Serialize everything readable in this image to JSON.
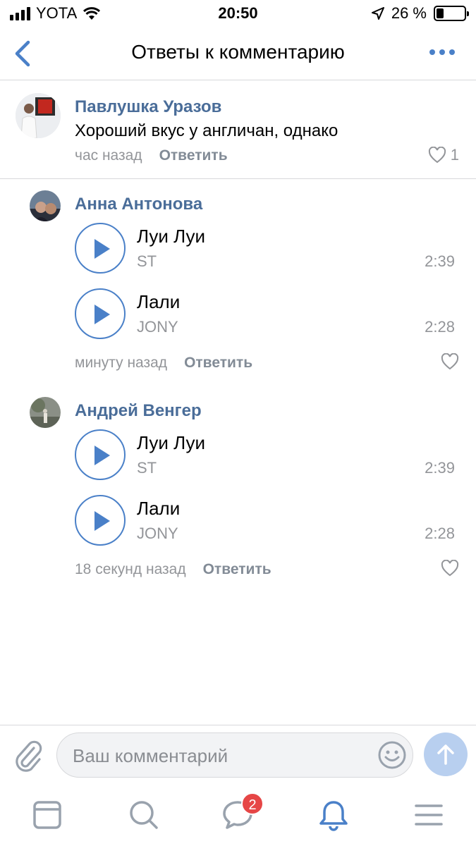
{
  "status_bar": {
    "carrier": "YOTA",
    "time": "20:50",
    "battery": "26 %",
    "battery_level": 0.26
  },
  "nav": {
    "title": "Ответы к комментарию"
  },
  "parent_comment": {
    "author": "Павлушка Уразов",
    "text": "Хороший вкус у англичан, однако",
    "time": "час назад",
    "reply_label": "Ответить",
    "likes": "1"
  },
  "replies": [
    {
      "author": "Анна Антонова",
      "tracks": [
        {
          "title": "Луи Луи",
          "artist": "ST",
          "duration": "2:39"
        },
        {
          "title": "Лали",
          "artist": "JONY",
          "duration": "2:28"
        }
      ],
      "time": "минуту назад",
      "reply_label": "Ответить"
    },
    {
      "author": "Андрей Венгер",
      "tracks": [
        {
          "title": "Луи Луи",
          "artist": "ST",
          "duration": "2:39"
        },
        {
          "title": "Лали",
          "artist": "JONY",
          "duration": "2:28"
        }
      ],
      "time": "18 секунд назад",
      "reply_label": "Ответить"
    }
  ],
  "composer": {
    "placeholder": "Ваш комментарий"
  },
  "tab_bar": {
    "items": [
      "news-icon",
      "search-icon",
      "messages-icon",
      "notifications-icon",
      "menu-icon"
    ],
    "messages_badge": "2",
    "active": "notifications-icon"
  },
  "colors": {
    "accent": "#4a80c8",
    "author": "#4a6d99",
    "secondary_text": "#939599",
    "badge": "#e64646"
  }
}
